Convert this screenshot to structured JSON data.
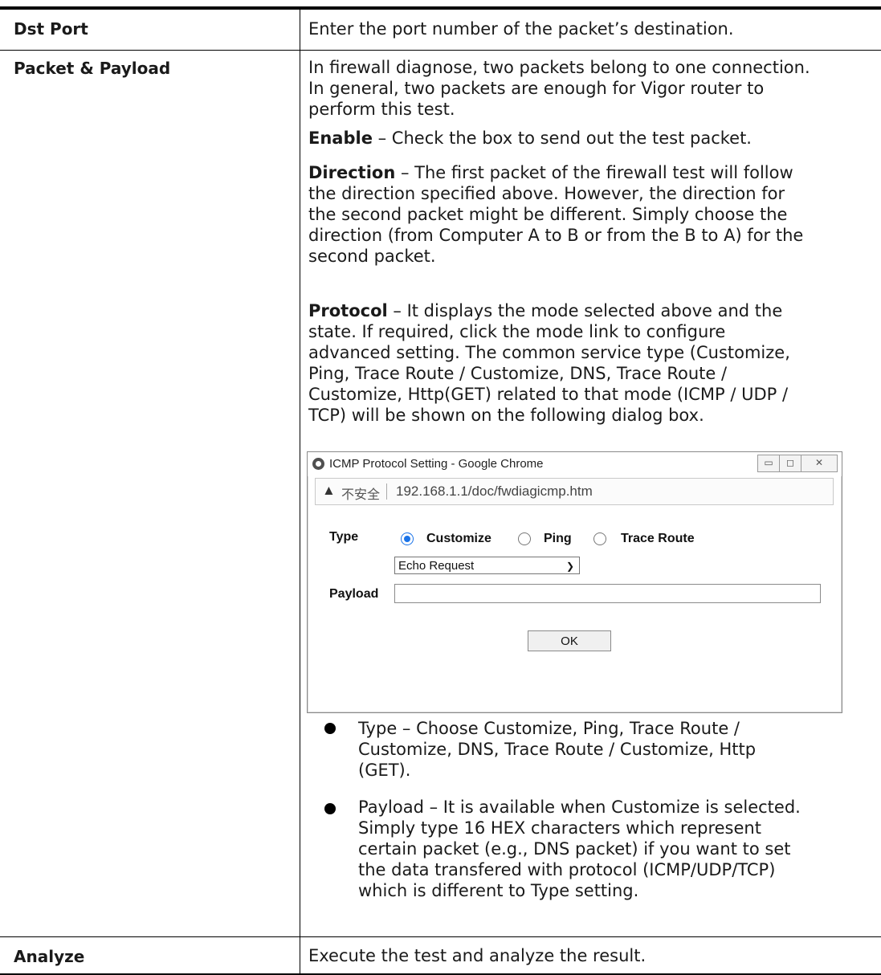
{
  "rows": [
    {
      "label": "Dst Port",
      "text": "Enter the port number of the packet’s destination."
    },
    {
      "label": "Packet & Payload"
    },
    {
      "label": "Analyze",
      "text": "Execute the test and analyze the result."
    }
  ],
  "packet": {
    "intro_l1": "In firewall diagnose, two packets belong to one connection.",
    "intro_l2": "In general, two packets are enough for Vigor router to",
    "intro_l3": "perform this test.",
    "enable_term": "Enable",
    "enable_desc": " – Check the box to send out the test packet.",
    "direction_term": "Direction",
    "direction_l1": " – The first packet of the firewall test will follow",
    "direction_l2": "the direction specified above. However, the direction for",
    "direction_l3": "the second packet might be different. Simply choose the",
    "direction_l4": "direction (from Computer A to B or from the B to A) for the",
    "direction_l5": "second packet.",
    "protocol_term": "Protocol",
    "protocol_l1": " – It displays the mode selected above and the",
    "protocol_l2": "state. If required, click the mode link to configure",
    "protocol_l3": "advanced setting. The common service type (Customize,",
    "protocol_l4": "Ping, Trace Route / Customize, DNS, Trace Route /",
    "protocol_l5": "Customize, Http(GET) related to that mode (ICMP / UDP /",
    "protocol_l6": "TCP) will be shown on the following dialog box."
  },
  "dialog": {
    "title": "ICMP Protocol Setting - Google Chrome",
    "btn_min": "▭",
    "btn_max": "◻",
    "btn_close": "✕",
    "warn_glyph": "▲",
    "insecure": "不安全",
    "url": "192.168.1.1/doc/fwdiagicmp.htm",
    "type_label": "Type",
    "opt_customize": "Customize",
    "opt_ping": "Ping",
    "opt_trace": "Trace Route",
    "select_value": "Echo Request",
    "payload_label": "Payload",
    "payload_value": "",
    "ok": "OK"
  },
  "bullets": {
    "type_term": "Type",
    "type_l1": " – Choose Customize, Ping, Trace Route /",
    "type_l2": "Customize, DNS, Trace Route / Customize, Http",
    "type_l3": "(GET).",
    "payload_term": "Payload",
    "payload_l1": " – It is available when Customize is selected.",
    "payload_l2": "Simply type 16 HEX characters which represent",
    "payload_l3": "certain packet (e.g., DNS packet) if you want to set",
    "payload_l4": "the data transfered with protocol (ICMP/UDP/TCP)",
    "payload_l5": "which is different to Type setting."
  }
}
